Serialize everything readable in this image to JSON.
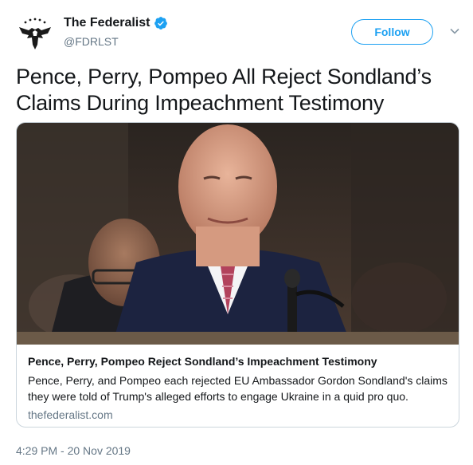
{
  "account": {
    "display_name": "The Federalist",
    "handle": "@FDRLST",
    "verified": true,
    "avatar_icon": "eagle-logo-icon"
  },
  "actions": {
    "follow_label": "Follow",
    "menu_icon": "chevron-down-icon"
  },
  "tweet": {
    "text": "Pence, Perry, Pompeo All Reject Sondland’s Claims During Impeachment Testimony",
    "timestamp": "4:29 PM - 20 Nov 2019"
  },
  "card": {
    "title": "Pence, Perry, Pompeo Reject Sondland’s Impeachment Testimony",
    "description": "Pence, Perry, and Pompeo each rejected EU Ambassador Gordon Sondland's claims they were told of Trump's alleged efforts to engage Ukraine in a quid pro quo.",
    "domain": "thefederalist.com"
  },
  "colors": {
    "accent": "#1da1f2",
    "text": "#14171a",
    "secondary": "#657786",
    "border": "#ccd6dd"
  }
}
